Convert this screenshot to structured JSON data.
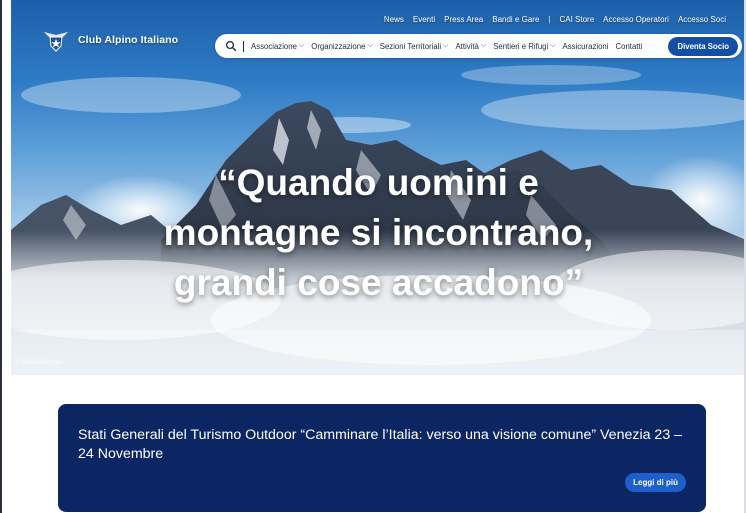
{
  "brand": {
    "name": "Club Alpino Italiano",
    "logo_icon": "cai-star-eagle-logo"
  },
  "top_links": [
    "News",
    "Eventi",
    "Press Area",
    "Bandi e Gare",
    "|",
    "CAI Store",
    "Accesso Operatori",
    "Accesso Soci"
  ],
  "nav": {
    "items": [
      {
        "label": "Associazione",
        "dropdown": "⌵"
      },
      {
        "label": "Organizzazione",
        "dropdown": "⌵"
      },
      {
        "label": "Sezioni Territoriali",
        "dropdown": "⌵"
      },
      {
        "label": "Attività",
        "dropdown": "⌵"
      },
      {
        "label": "Sentieri e Rifugi",
        "dropdown": "⌵"
      },
      {
        "label": "Assicurazioni",
        "dropdown": ""
      },
      {
        "label": "Contatti",
        "dropdown": ""
      }
    ],
    "cta": "Diventa Socio",
    "accent": "#1350a5"
  },
  "hero": {
    "quote_line1": "“Quando uomini e",
    "quote_line2": "montagne si incontrano,",
    "quote_line3": "grandi cose accadono”",
    "credit": "© Silvia Mazzani"
  },
  "news_card": {
    "title": "Stati Generali del Turismo Outdoor “Camminare l’Italia: verso una visione comune” Venezia 23 – 24 Novembre",
    "button": "Leggi di più",
    "background": "#0c2563"
  }
}
